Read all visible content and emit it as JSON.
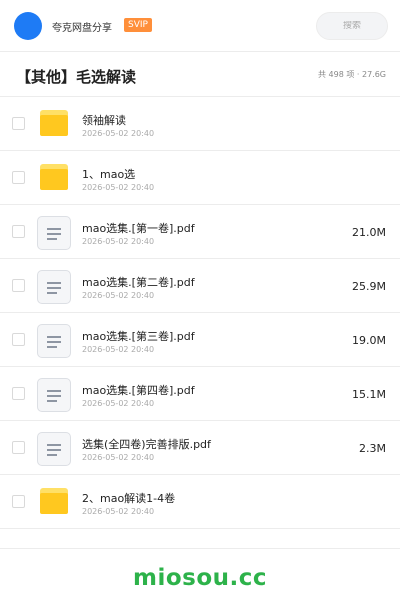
{
  "header": {
    "share_name": "夸克网盘分享",
    "badge": "SVIP",
    "search_placeholder": "搜索",
    "avatar_color": "#1e7bf5",
    "badge_color": "#ff8f3a"
  },
  "folder": {
    "title": "【其他】毛选解读",
    "stats": "共 498 项 · 27.6G"
  },
  "items": [
    {
      "type": "folder",
      "icon": "folder-icon",
      "name": "领袖解读",
      "date": "2026-05-02 20:40",
      "size": ""
    },
    {
      "type": "folder",
      "icon": "folder-icon",
      "name": "1、mao选",
      "date": "2026-05-02 20:40",
      "size": ""
    },
    {
      "type": "file",
      "icon": "document-icon",
      "name": "mao选集.[第一卷].pdf",
      "date": "2026-05-02 20:40",
      "size": "21.0M"
    },
    {
      "type": "file",
      "icon": "document-icon",
      "name": "mao选集.[第二卷].pdf",
      "date": "2026-05-02 20:40",
      "size": "25.9M"
    },
    {
      "type": "file",
      "icon": "document-icon",
      "name": "mao选集.[第三卷].pdf",
      "date": "2026-05-02 20:40",
      "size": "19.0M"
    },
    {
      "type": "file",
      "icon": "document-icon",
      "name": "mao选集.[第四卷].pdf",
      "date": "2026-05-02 20:40",
      "size": "15.1M"
    },
    {
      "type": "file",
      "icon": "document-icon",
      "name": "选集(全四卷)完善排版.pdf",
      "date": "2026-05-02 20:40",
      "size": "2.3M"
    },
    {
      "type": "folder",
      "icon": "folder-icon",
      "name": "2、mao解读1-4卷",
      "date": "2026-05-02 20:40",
      "size": ""
    }
  ],
  "watermark": "miosou.cc",
  "colors": {
    "folder": "#ffc81f",
    "watermark": "#2db24a"
  }
}
